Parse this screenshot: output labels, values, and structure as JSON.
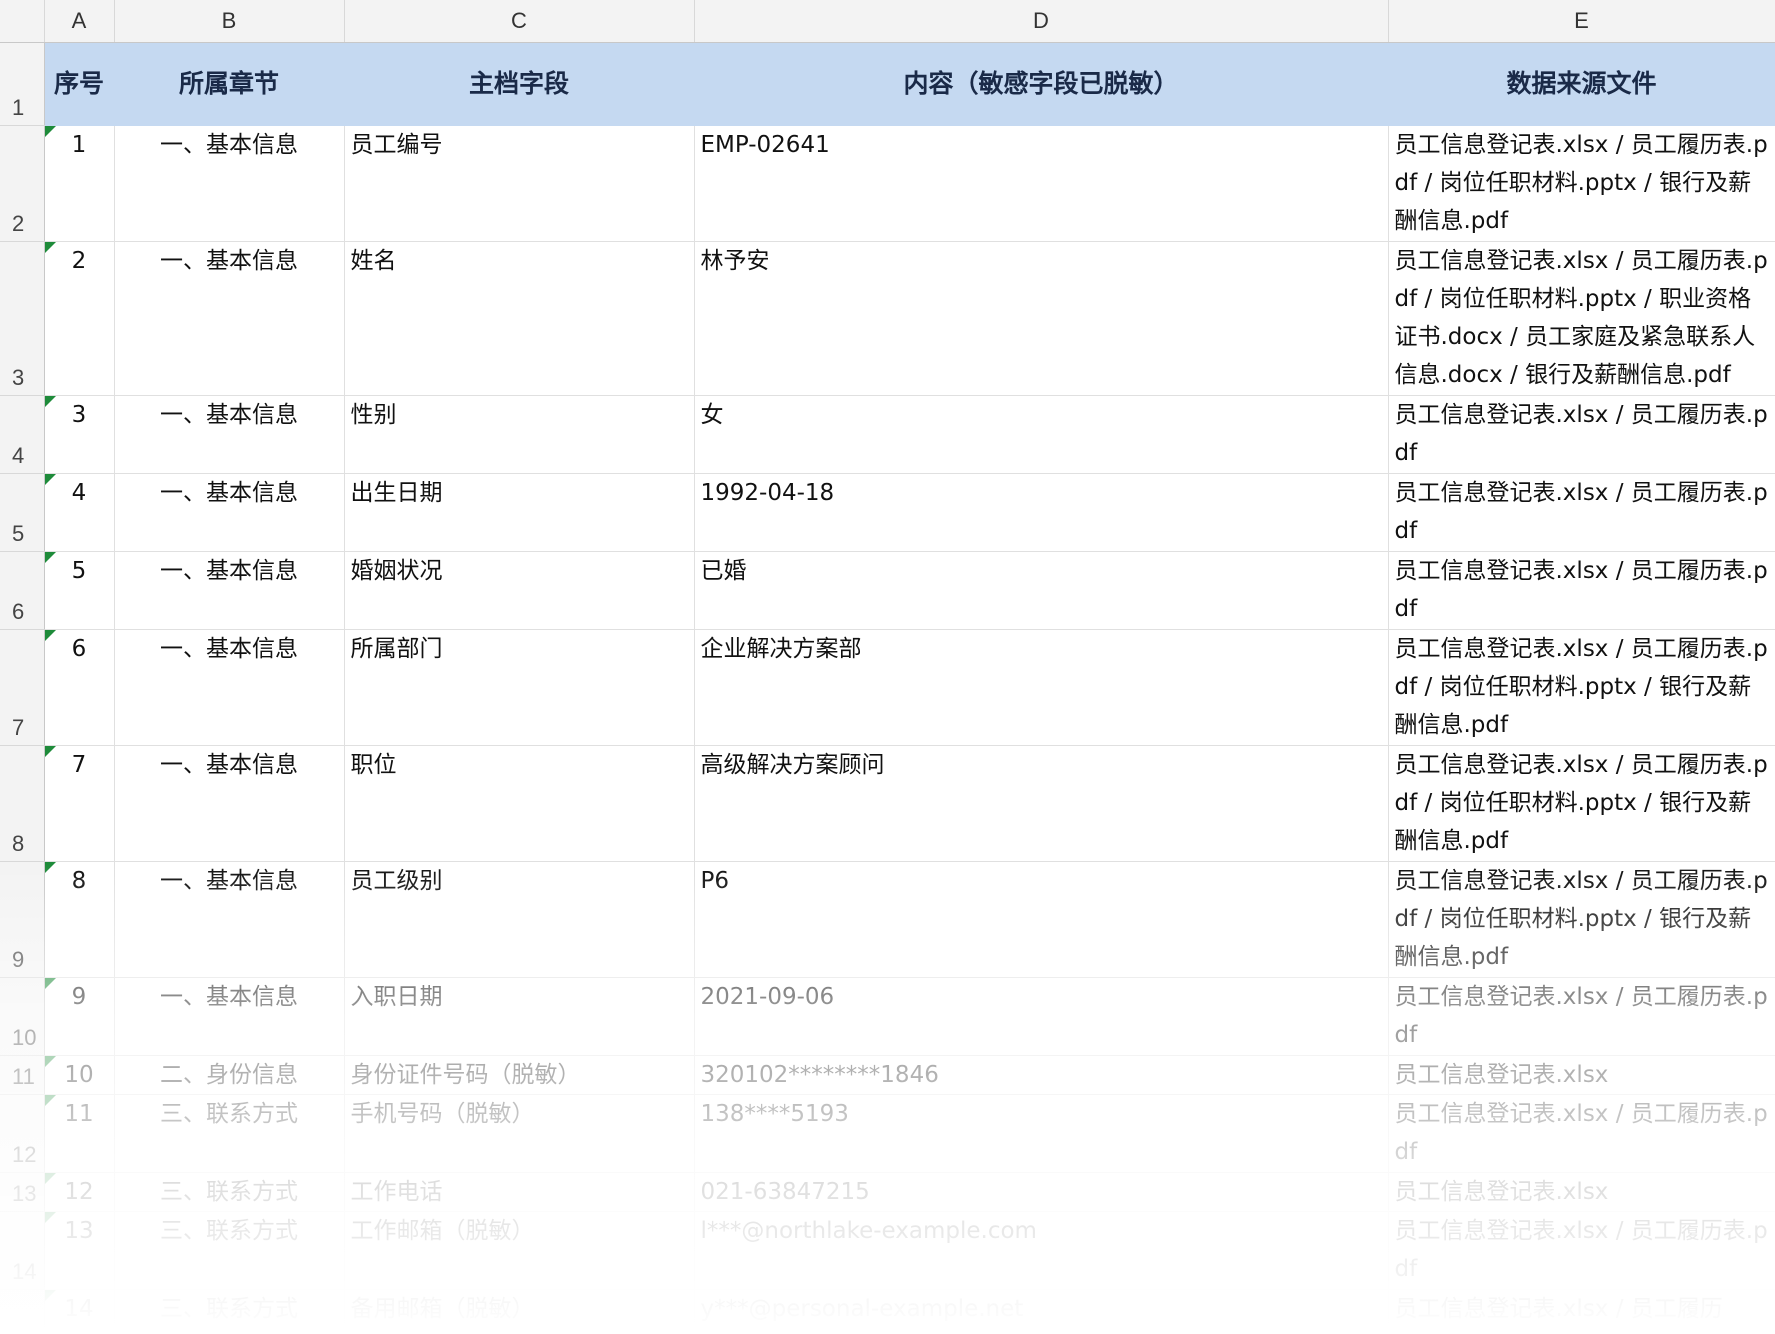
{
  "columns": [
    "A",
    "B",
    "C",
    "D",
    "E"
  ],
  "header": {
    "row_number": "1",
    "cells": [
      "序号",
      "所属章节",
      "主档字段",
      "内容（敏感字段已脱敏）",
      "数据来源文件"
    ]
  },
  "rows": [
    {
      "row_number": "2",
      "cells": [
        "1",
        "一、基本信息",
        "员工编号",
        "EMP-02641",
        "员工信息登记表.xlsx / 员工履历表.pdf / 岗位任职材料.pptx / 银行及薪酬信息.pdf"
      ]
    },
    {
      "row_number": "3",
      "cells": [
        "2",
        "一、基本信息",
        "姓名",
        "林予安",
        "员工信息登记表.xlsx / 员工履历表.pdf / 岗位任职材料.pptx / 职业资格证书.docx / 员工家庭及紧急联系人信息.docx / 银行及薪酬信息.pdf"
      ]
    },
    {
      "row_number": "4",
      "cells": [
        "3",
        "一、基本信息",
        "性别",
        "女",
        "员工信息登记表.xlsx / 员工履历表.pdf"
      ]
    },
    {
      "row_number": "5",
      "cells": [
        "4",
        "一、基本信息",
        "出生日期",
        "1992-04-18",
        "员工信息登记表.xlsx / 员工履历表.pdf"
      ]
    },
    {
      "row_number": "6",
      "cells": [
        "5",
        "一、基本信息",
        "婚姻状况",
        "已婚",
        "员工信息登记表.xlsx / 员工履历表.pdf"
      ]
    },
    {
      "row_number": "7",
      "cells": [
        "6",
        "一、基本信息",
        "所属部门",
        "企业解决方案部",
        "员工信息登记表.xlsx / 员工履历表.pdf / 岗位任职材料.pptx / 银行及薪酬信息.pdf"
      ]
    },
    {
      "row_number": "8",
      "cells": [
        "7",
        "一、基本信息",
        "职位",
        "高级解决方案顾问",
        "员工信息登记表.xlsx / 员工履历表.pdf / 岗位任职材料.pptx / 银行及薪酬信息.pdf"
      ]
    },
    {
      "row_number": "9",
      "cells": [
        "8",
        "一、基本信息",
        "员工级别",
        "P6",
        "员工信息登记表.xlsx / 员工履历表.pdf / 岗位任职材料.pptx / 银行及薪酬信息.pdf"
      ]
    },
    {
      "row_number": "10",
      "cells": [
        "9",
        "一、基本信息",
        "入职日期",
        "2021-09-06",
        "员工信息登记表.xlsx / 员工履历表.pdf"
      ]
    },
    {
      "row_number": "11",
      "cells": [
        "10",
        "二、身份信息",
        "身份证件号码（脱敏）",
        "320102********1846",
        "员工信息登记表.xlsx"
      ]
    },
    {
      "row_number": "12",
      "cells": [
        "11",
        "三、联系方式",
        "手机号码（脱敏）",
        "138****5193",
        "员工信息登记表.xlsx / 员工履历表.pdf"
      ]
    },
    {
      "row_number": "13",
      "cells": [
        "12",
        "三、联系方式",
        "工作电话",
        "021-63847215",
        "员工信息登记表.xlsx"
      ]
    },
    {
      "row_number": "14",
      "cells": [
        "13",
        "三、联系方式",
        "工作邮箱（脱敏）",
        "l***@northlake-example.com",
        "员工信息登记表.xlsx / 员工履历表.pdf"
      ]
    },
    {
      "row_number": "",
      "cells": [
        "14",
        "三、联系方式",
        "备用邮箱（脱敏）",
        "y***@personal-example.net",
        "员工信息登记表.xlsx / 员工履历"
      ]
    }
  ]
}
